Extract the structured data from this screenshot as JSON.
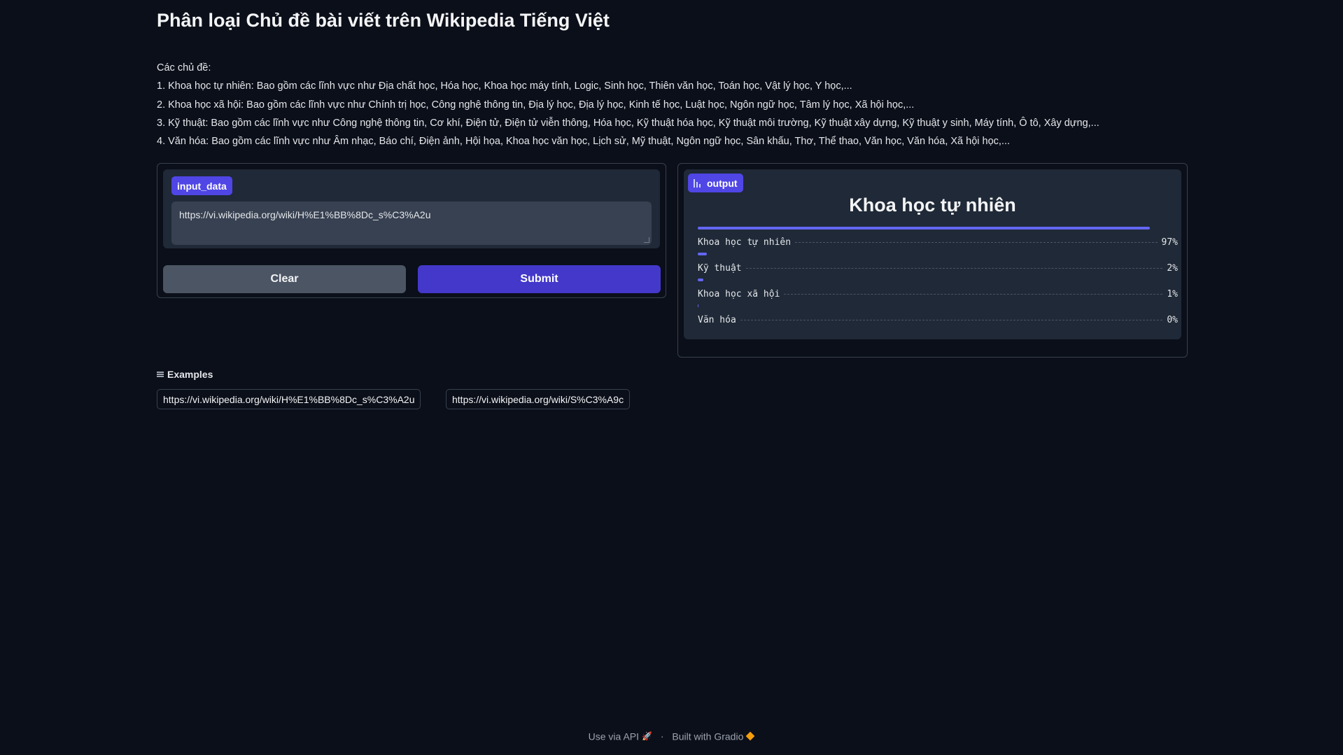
{
  "page": {
    "title": "Phân loại Chủ đề bài viết trên Wikipedia Tiếng Việt"
  },
  "description": {
    "heading": "Các chủ đề:",
    "lines": [
      "1. Khoa học tự nhiên: Bao gồm các lĩnh vực như Địa chất học, Hóa học, Khoa học máy tính, Logic, Sinh học, Thiên văn học, Toán học, Vật lý học, Y học,...",
      "2. Khoa học xã hội: Bao gồm các lĩnh vực như Chính trị học, Công nghệ thông tin, Địa lý học, Địa lý học, Kinh tế học, Luật học, Ngôn ngữ học, Tâm lý học, Xã hội học,...",
      "3. Kỹ thuật: Bao gồm các lĩnh vực như Công nghệ thông tin, Cơ khí, Điện tử, Điện tử viễn thông, Hóa học, Kỹ thuật hóa học, Kỹ thuật môi trường, Kỹ thuật xây dựng, Kỹ thuật y sinh, Máy tính, Ô tô, Xây dựng,...",
      "4. Văn hóa: Bao gồm các lĩnh vực như Âm nhạc, Báo chí, Điện ảnh, Hội họa, Khoa học văn học, Lịch sử, Mỹ thuật, Ngôn ngữ học, Sân khấu, Thơ, Thể thao, Văn học, Văn hóa, Xã hội học,..."
    ]
  },
  "input": {
    "label": "input_data",
    "value": "https://vi.wikipedia.org/wiki/H%E1%BB%8Dc_s%C3%A2u",
    "clear_label": "Clear",
    "submit_label": "Submit"
  },
  "output": {
    "label": "output",
    "icon": "bar-chart-icon",
    "top_label": "Khoa học tự nhiên",
    "confidences": [
      {
        "label": "Khoa học tự nhiên",
        "percent_text": "97%",
        "fraction": 0.97
      },
      {
        "label": "Kỹ thuật",
        "percent_text": "2%",
        "fraction": 0.02
      },
      {
        "label": "Khoa học xã hội",
        "percent_text": "1%",
        "fraction": 0.01
      },
      {
        "label": "Văn hóa",
        "percent_text": "0%",
        "fraction": 0.0
      }
    ],
    "bar_color": "#6366f1"
  },
  "examples": {
    "heading": "Examples",
    "items": [
      "https://vi.wikipedia.org/wiki/H%E1%BB%8Dc_s%C3%A2u",
      "https://vi.wikipedia.org/wiki/S%C3%A9c"
    ]
  },
  "footer": {
    "api_text": "Use via API",
    "separator": "·",
    "built_text": "Built with Gradio"
  },
  "colors": {
    "background": "#0b0f19",
    "accent": "#4f46e5",
    "panel": "#1f2937"
  }
}
